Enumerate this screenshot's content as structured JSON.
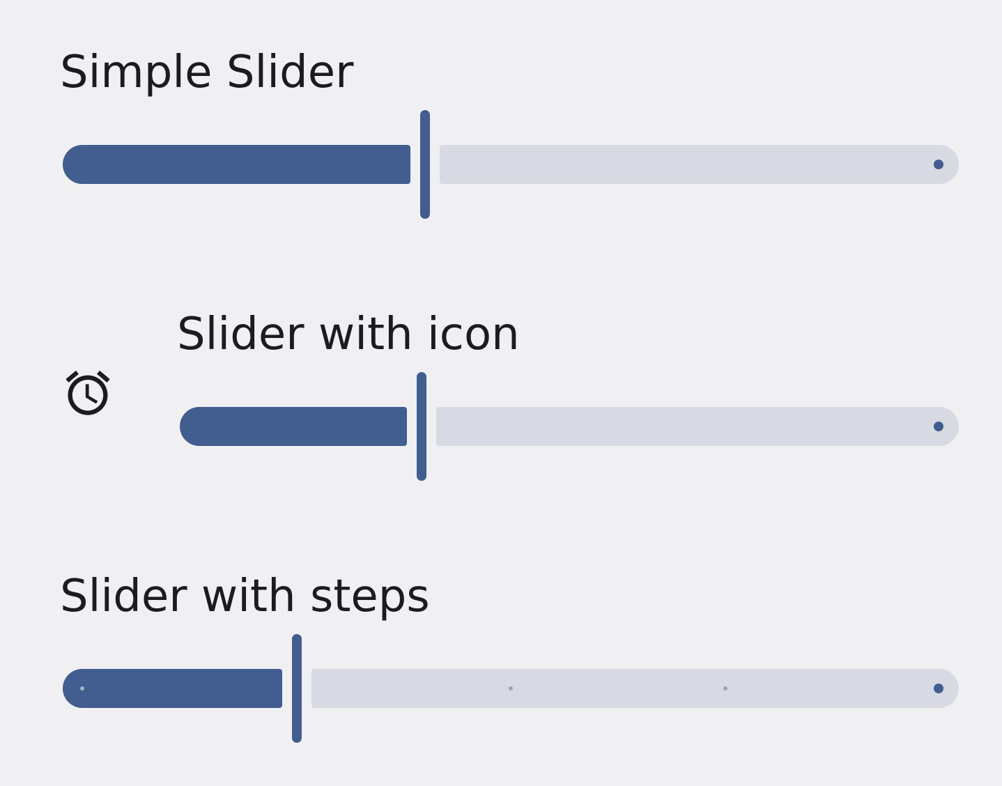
{
  "sliders": {
    "simple": {
      "title": "Simple Slider",
      "value": 0.4
    },
    "with_icon": {
      "title": "Slider with icon",
      "value": 0.3,
      "icon": "alarm-icon"
    },
    "with_steps": {
      "title": "Slider with steps",
      "value": 0.25,
      "steps": 5
    }
  },
  "colors": {
    "background": "#f0f0f3",
    "active_track": "#425d8f",
    "inactive_track": "#d8dae3",
    "text": "#1c1b1f"
  }
}
